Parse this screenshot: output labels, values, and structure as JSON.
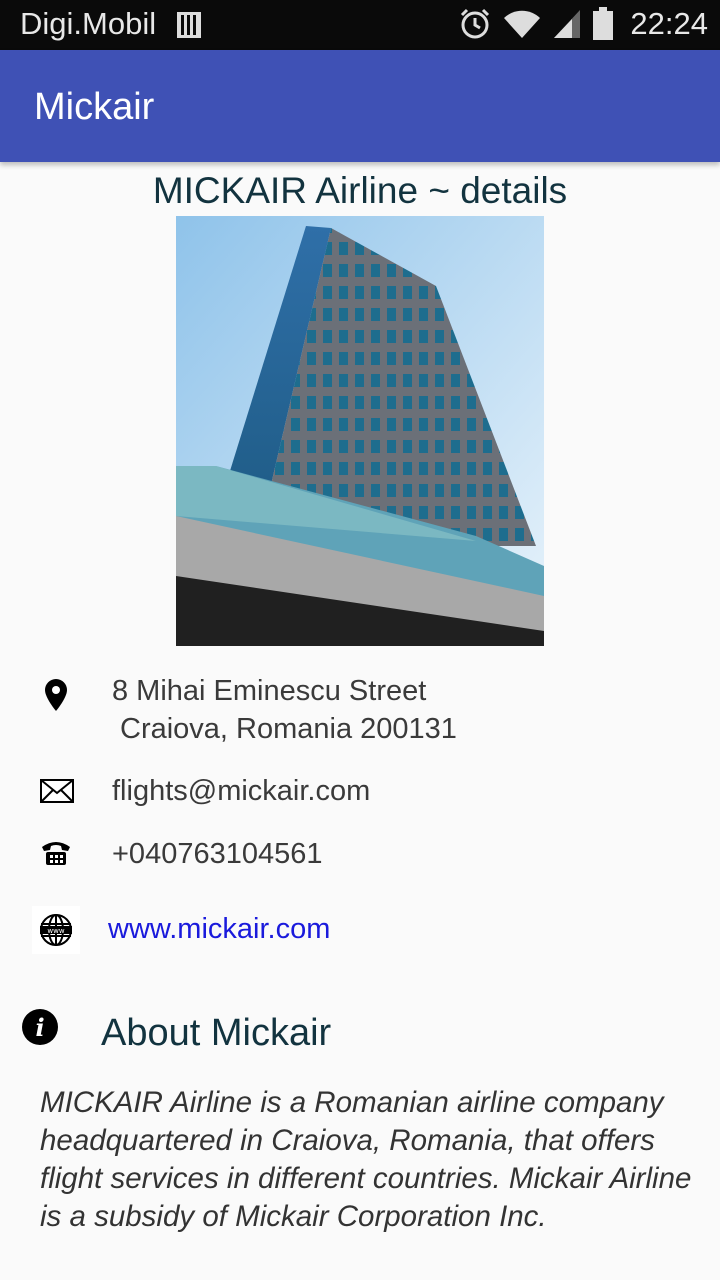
{
  "status_bar": {
    "carrier": "Digi.Mobil",
    "time": "22:24",
    "icons": [
      "sim-card-icon",
      "alarm-icon",
      "wifi-icon",
      "signal-icon",
      "battery-icon"
    ]
  },
  "app_bar": {
    "title": "Mickair",
    "color": "#3f51b5"
  },
  "details": {
    "title": "MICKAIR Airline ~ details",
    "address_line1": "8 Mihai Eminescu Street",
    "address_line2": "Craiova, Romania 200131",
    "email": "flights@mickair.com",
    "phone": "+040763104561",
    "website": "www.mickair.com"
  },
  "about": {
    "heading": "About Mickair",
    "body": "MICKAIR Airline is a Romanian airline company headquartered in Craiova, Romania, that offers flight services in different countries. Mickair Airline is a subsidy of Mickair Corporation Inc."
  }
}
